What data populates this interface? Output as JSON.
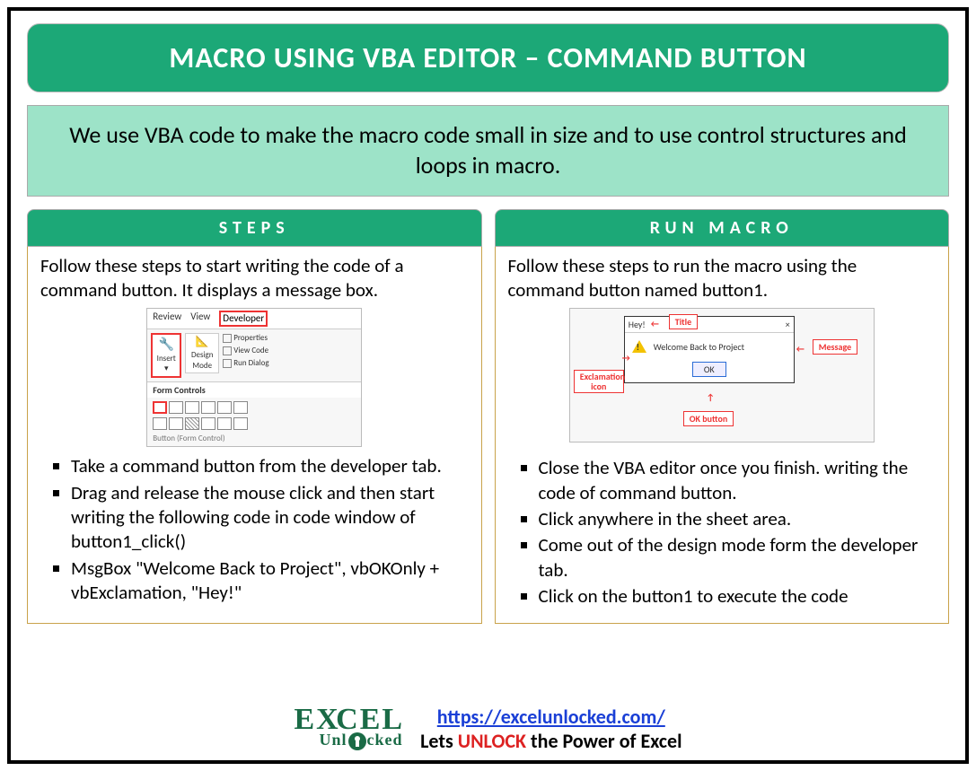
{
  "title": "MACRO USING VBA EDITOR – COMMAND BUTTON",
  "subtitle": "We use VBA code to make the macro code small in size and to use control structures and loops in macro.",
  "left": {
    "heading": "STEPS",
    "intro": "Follow these steps to start writing the code of a command button. It displays a message box.",
    "ribbon": {
      "tabs": [
        "Review",
        "View",
        "Developer"
      ],
      "insert": "Insert",
      "design": "Design Mode",
      "props": "Properties",
      "viewcode": "View Code",
      "rundlg": "Run Dialog",
      "formControls": "Form Controls",
      "caption": "Button (Form Control)"
    },
    "bullets": [
      "Take a command button from the developer tab.",
      "Drag and release the mouse click and then start writing the following code in code window of button1_click()",
      "MsgBox \"Welcome Back to Project\", vbOKOnly + vbExclamation, \"Hey!\""
    ]
  },
  "right": {
    "heading": "RUN MACRO",
    "intro": "Follow these steps to run the macro using the command button named button1.",
    "msgbox": {
      "titleText": "Hey!",
      "close": "×",
      "bodyText": "Welcome Back to Project",
      "ok": "OK",
      "labelTitle": "Title",
      "labelMessage": "Message",
      "labelIcon": "Exclamation icon",
      "labelOk": "OK button"
    },
    "bullets": [
      "Close the VBA editor once you finish. writing the code of command button.",
      "Click anywhere in the sheet area.",
      "Come out of the design mode form the developer tab.",
      "Click on the button1 to execute the code"
    ]
  },
  "footer": {
    "logoTop": "E   CEL",
    "logoBottom": "Unl  cked",
    "url": "https://excelunlocked.com/",
    "tag_pre": "Lets ",
    "tag_word": "UNLOCK",
    "tag_post": " the Power of Excel"
  }
}
